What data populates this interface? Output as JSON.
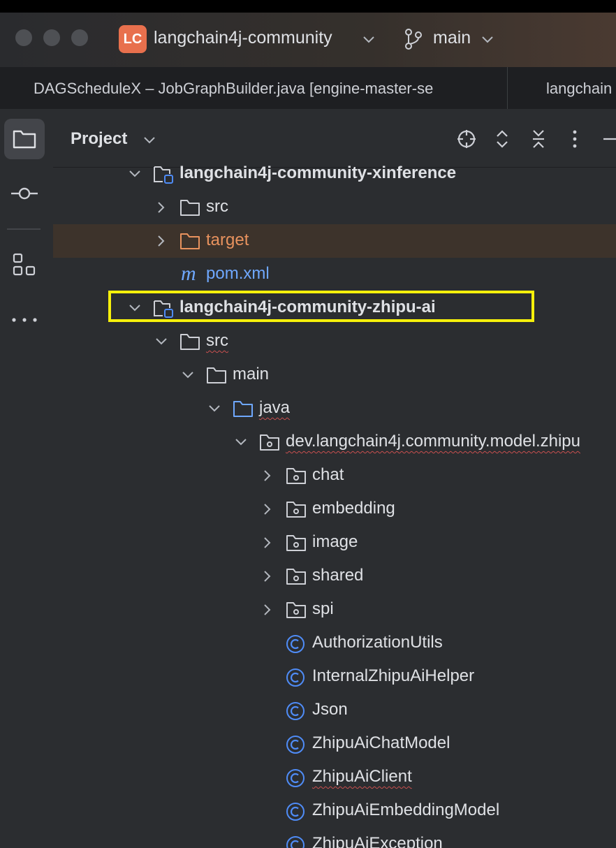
{
  "titlebar": {
    "badge": "LC",
    "project": "langchain4j-community",
    "branch": "main"
  },
  "tabs": [
    "DAGScheduleX – JobGraphBuilder.java [engine-master-se",
    "langchain"
  ],
  "panel": {
    "title": "Project"
  },
  "tree": [
    {
      "label": "langchain4j-community-xinference",
      "arrow": "down",
      "icon": "module-icon",
      "bold": true
    },
    {
      "label": "src",
      "arrow": "right",
      "icon": "folder-icon"
    },
    {
      "label": "target",
      "arrow": "right",
      "icon": "folder-orange-icon",
      "style": "orange"
    },
    {
      "label": "pom.xml",
      "arrow": "",
      "icon": "maven-icon",
      "style": "blue"
    },
    {
      "label": "langchain4j-community-zhipu-ai",
      "arrow": "down",
      "icon": "module-icon",
      "bold": true
    },
    {
      "label": "src",
      "arrow": "down",
      "icon": "folder-icon"
    },
    {
      "label": "main",
      "arrow": "down",
      "icon": "folder-icon"
    },
    {
      "label": "java",
      "arrow": "down",
      "icon": "folder-blue-icon"
    },
    {
      "label": "dev.langchain4j.community.model.zhipu",
      "arrow": "down",
      "icon": "package-icon"
    },
    {
      "label": "chat",
      "arrow": "right",
      "icon": "package-icon"
    },
    {
      "label": "embedding",
      "arrow": "right",
      "icon": "package-icon"
    },
    {
      "label": "image",
      "arrow": "right",
      "icon": "package-icon"
    },
    {
      "label": "shared",
      "arrow": "right",
      "icon": "package-icon"
    },
    {
      "label": "spi",
      "arrow": "right",
      "icon": "package-icon"
    },
    {
      "label": "AuthorizationUtils",
      "arrow": "",
      "icon": "class-icon"
    },
    {
      "label": "InternalZhipuAiHelper",
      "arrow": "",
      "icon": "class-icon"
    },
    {
      "label": "Json",
      "arrow": "",
      "icon": "class-icon"
    },
    {
      "label": "ZhipuAiChatModel",
      "arrow": "",
      "icon": "class-icon"
    },
    {
      "label": "ZhipuAiClient",
      "arrow": "",
      "icon": "class-icon"
    },
    {
      "label": "ZhipuAiEmbeddingModel",
      "arrow": "",
      "icon": "class-icon"
    },
    {
      "label": "ZhipuAiException",
      "arrow": "",
      "icon": "class-icon"
    }
  ],
  "colors": {
    "accent": "#e8704d",
    "highlight": "#f6f00b",
    "class_icon": "#4f8cf7"
  }
}
